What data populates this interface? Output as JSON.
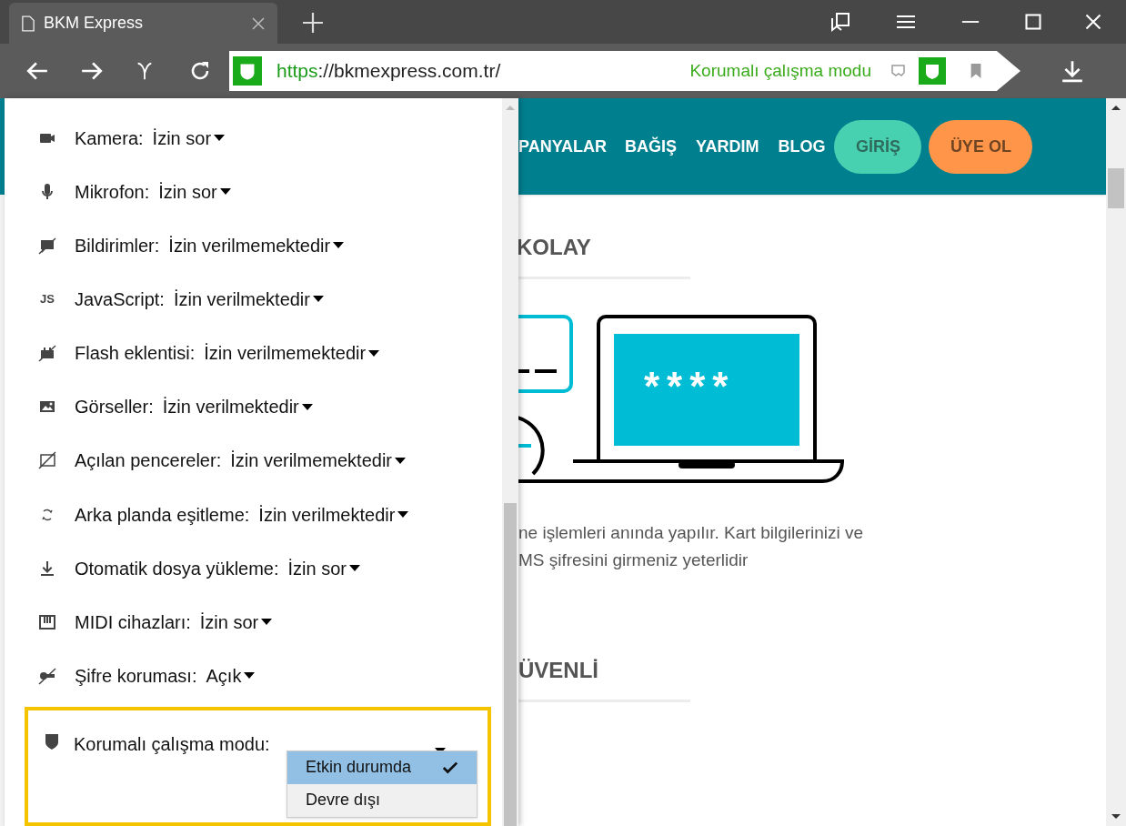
{
  "browser": {
    "tab": {
      "title": "BKM Express"
    },
    "address": {
      "scheme": "https",
      "rest": "://bkmexpress.com.tr/"
    },
    "protected_mode_label": "Korumalı çalışma modu"
  },
  "site_permissions": {
    "items": [
      {
        "label": "Kamera:",
        "value": "İzin sor"
      },
      {
        "label": "Mikrofon:",
        "value": "İzin sor"
      },
      {
        "label": "Bildirimler:",
        "value": "İzin verilmemektedir"
      },
      {
        "label": "JavaScript:",
        "value": "İzin verilmektedir",
        "icon_text": "JS"
      },
      {
        "label": "Flash eklentisi:",
        "value": "İzin verilmemektedir"
      },
      {
        "label": "Görseller:",
        "value": "İzin verilmektedir"
      },
      {
        "label": "Açılan pencereler:",
        "value": "İzin verilmemektedir"
      },
      {
        "label": "Arka planda eşitleme:",
        "value": "İzin verilmektedir"
      },
      {
        "label": "Otomatik dosya yükleme:",
        "value": "İzin sor"
      },
      {
        "label": "MIDI cihazları:",
        "value": "İzin sor"
      },
      {
        "label": "Şifre koruması:",
        "value": "Açık"
      }
    ],
    "protected_mode": {
      "label": "Korumalı çalışma modu:",
      "options": [
        {
          "label": "Etkin durumda",
          "selected": true
        },
        {
          "label": "Devre dışı",
          "selected": false
        }
      ]
    }
  },
  "website": {
    "nav": [
      "PANYALAR",
      "BAĞIŞ",
      "YARDIM",
      "BLOG"
    ],
    "login_button": "GİRİŞ",
    "signup_button": "ÜYE OL",
    "sections": [
      {
        "heading": "KOLAY",
        "screen_text": "****",
        "lines": [
          "ne işlemleri anında yapılır. Kart bilgilerinizi ve",
          "MS şifresini girmeniz yeterlidir"
        ]
      },
      {
        "heading": "ÜVENLİ"
      }
    ]
  }
}
